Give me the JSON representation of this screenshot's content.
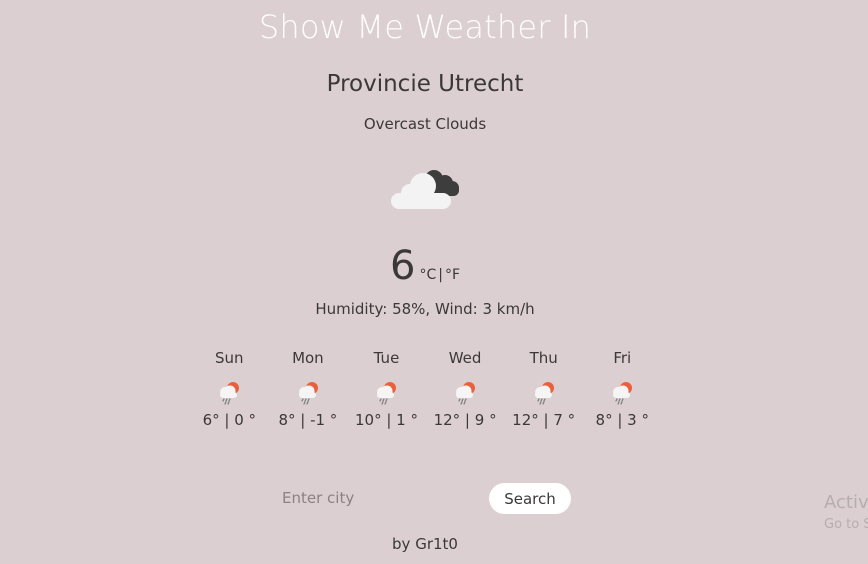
{
  "app": {
    "title": "Show Me Weather In"
  },
  "current": {
    "city": "Provincie Utrecht",
    "description": "Overcast Clouds",
    "icon": "overcast-clouds-icon",
    "temperature": "6",
    "unit_c": "°C",
    "unit_separator": "|",
    "unit_f": "°F",
    "details": "Humidity: 58%, Wind: 3 km/h"
  },
  "forecast": [
    {
      "day": "Sun",
      "temps": "6° | 0 °",
      "icon": "light-rain-sun-icon"
    },
    {
      "day": "Mon",
      "temps": "8° | -1 °",
      "icon": "light-rain-sun-icon"
    },
    {
      "day": "Tue",
      "temps": "10° | 1 °",
      "icon": "light-rain-sun-icon"
    },
    {
      "day": "Wed",
      "temps": "12° | 9 °",
      "icon": "light-rain-sun-icon"
    },
    {
      "day": "Thu",
      "temps": "12° | 7 °",
      "icon": "light-rain-sun-icon"
    },
    {
      "day": "Fri",
      "temps": "8° | 3 °",
      "icon": "light-rain-sun-icon"
    }
  ],
  "search": {
    "placeholder": "Enter city",
    "value": "",
    "button_label": "Search"
  },
  "footer": {
    "author": "by Gr1t0"
  },
  "overlay": {
    "activate_title": "Activ",
    "activate_sub": "Go to S"
  },
  "colors": {
    "background": "#dccfd1",
    "title": "#ffffff",
    "text": "#3b3838",
    "sun": "#e8613c"
  }
}
